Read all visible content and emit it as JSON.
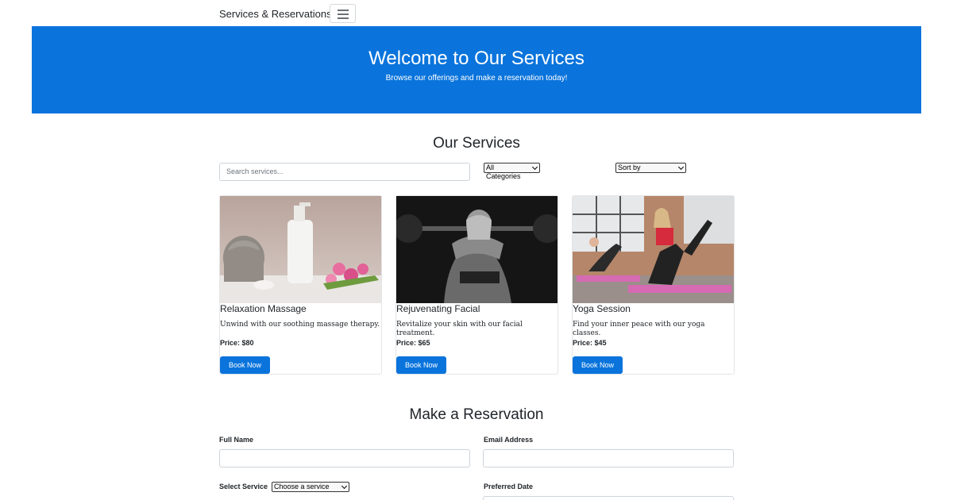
{
  "navbar": {
    "brand": "Services & Reservations",
    "toggler_icon": "hamburger-icon"
  },
  "hero": {
    "title": "Welcome to Our Services",
    "subtitle": "Browse our offerings and make a reservation today!",
    "background": "#0a74dc"
  },
  "services": {
    "title": "Our Services",
    "search_placeholder": "Search services...",
    "category_select": {
      "selected": "All Categories"
    },
    "sort_select": {
      "selected": "Sort by"
    },
    "cards": [
      {
        "title": "Relaxation Massage",
        "description": "Unwind with our soothing massage therapy.",
        "price": "Price: $80",
        "button": "Book Now",
        "image": "spa-still-life"
      },
      {
        "title": "Rejuvenating Facial",
        "description": "Revitalize your skin with our facial treatment.",
        "price": "Price: $65",
        "button": "Book Now",
        "image": "weightlifter-photo"
      },
      {
        "title": "Yoga Session",
        "description": "Find your inner peace with our yoga classes.",
        "price": "Price: $45",
        "button": "Book Now",
        "image": "yoga-class-photo"
      }
    ]
  },
  "reservation": {
    "title": "Make a Reservation",
    "full_name_label": "Full Name",
    "email_label": "Email Address",
    "service_label": "Select Service",
    "service_select": {
      "selected": "Choose a service"
    },
    "date_label": "Preferred Date"
  },
  "colors": {
    "accent": "#0a74dc",
    "text": "#212529",
    "border": "#ced4da"
  }
}
